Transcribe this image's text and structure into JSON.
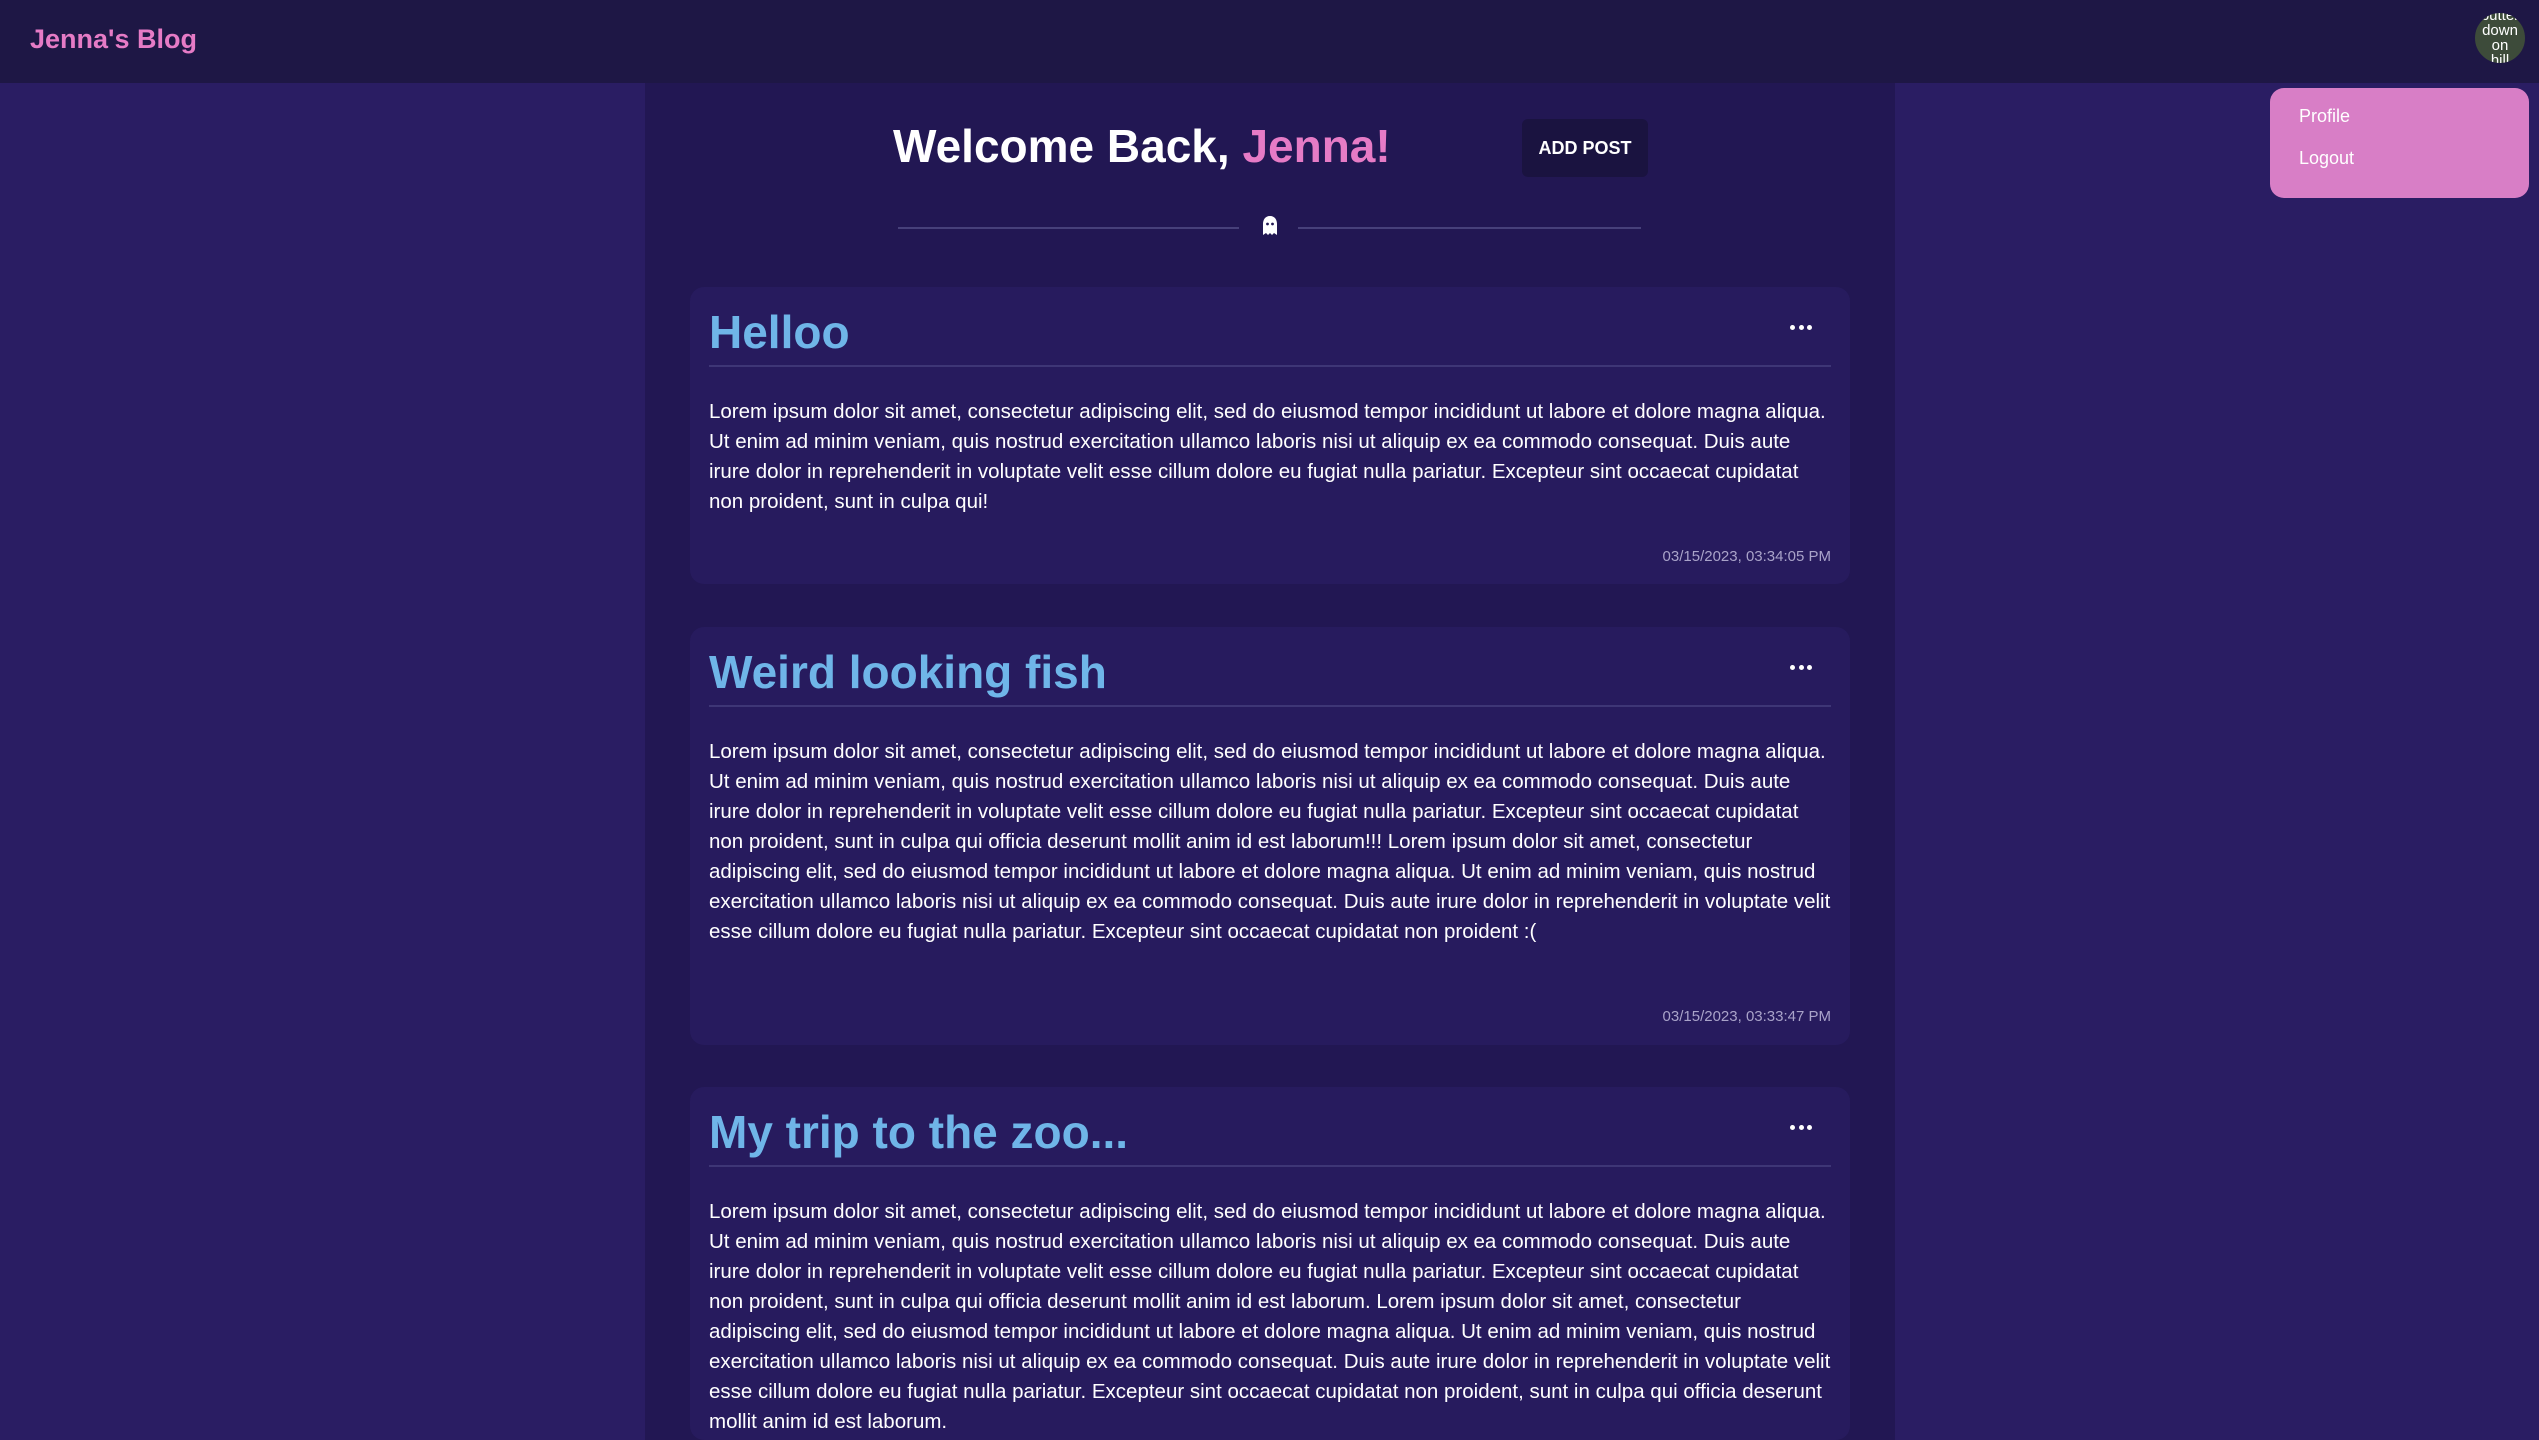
{
  "header": {
    "brand": "Jenna's Blog",
    "avatar_text": [
      "butter",
      "down",
      "on",
      "hill"
    ]
  },
  "user_menu": {
    "items": [
      {
        "label": "Profile"
      },
      {
        "label": "Logout"
      }
    ]
  },
  "welcome": {
    "prefix": "Welcome Back, ",
    "name": "Jenna!"
  },
  "actions": {
    "add_post_label": "ADD POST"
  },
  "posts": [
    {
      "title": "Helloo",
      "body": "Lorem ipsum dolor sit amet, consectetur adipiscing elit, sed do eiusmod tempor incididunt ut labore et dolore magna aliqua. Ut enim ad minim veniam, quis nostrud exercitation ullamco laboris nisi ut aliquip ex ea commodo consequat. Duis aute irure dolor in reprehenderit in voluptate velit esse cillum dolore eu fugiat nulla pariatur. Excepteur sint occaecat cupidatat non proident, sunt in culpa qui!",
      "date": "03/15/2023, 03:34:05 PM"
    },
    {
      "title": "Weird looking fish",
      "body": "Lorem ipsum dolor sit amet, consectetur adipiscing elit, sed do eiusmod tempor incididunt ut labore et dolore magna aliqua. Ut enim ad minim veniam, quis nostrud exercitation ullamco laboris nisi ut aliquip ex ea commodo consequat. Duis aute irure dolor in reprehenderit in voluptate velit esse cillum dolore eu fugiat nulla pariatur. Excepteur sint occaecat cupidatat non proident, sunt in culpa qui officia deserunt mollit anim id est laborum!!! Lorem ipsum dolor sit amet, consectetur adipiscing elit, sed do eiusmod tempor incididunt ut labore et dolore magna aliqua. Ut enim ad minim veniam, quis nostrud exercitation ullamco laboris nisi ut aliquip ex ea commodo consequat. Duis aute irure dolor in reprehenderit in voluptate velit esse cillum dolore eu fugiat nulla pariatur. Excepteur sint occaecat cupidatat non proident :(",
      "date": "03/15/2023, 03:33:47 PM"
    },
    {
      "title": "My trip to the zoo...",
      "body": "Lorem ipsum dolor sit amet, consectetur adipiscing elit, sed do eiusmod tempor incididunt ut labore et dolore magna aliqua. Ut enim ad minim veniam, quis nostrud exercitation ullamco laboris nisi ut aliquip ex ea commodo consequat. Duis aute irure dolor in reprehenderit in voluptate velit esse cillum dolore eu fugiat nulla pariatur. Excepteur sint occaecat cupidatat non proident, sunt in culpa qui officia deserunt mollit anim id est laborum. Lorem ipsum dolor sit amet, consectetur adipiscing elit, sed do eiusmod tempor incididunt ut labore et dolore magna aliqua. Ut enim ad minim veniam, quis nostrud exercitation ullamco laboris nisi ut aliquip ex ea commodo consequat. Duis aute irure dolor in reprehenderit in voluptate velit esse cillum dolore eu fugiat nulla pariatur. Excepteur sint occaecat cupidatat non proident, sunt in culpa qui officia deserunt mollit anim id est laborum."
    }
  ],
  "icons": {
    "divider": "ghost-icon",
    "post_menu": "more-horizontal-icon"
  },
  "colors": {
    "accent": "#e67bc6",
    "title": "#6fb5e8",
    "background": "#2a1d63",
    "panel": "#221753"
  }
}
